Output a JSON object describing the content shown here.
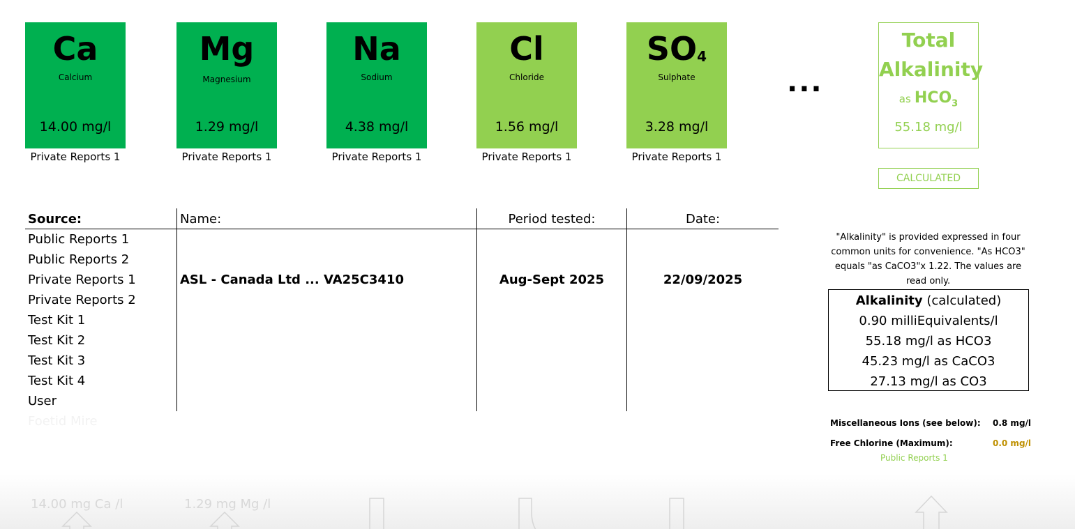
{
  "ions": [
    {
      "symbol": "Ca",
      "subscript": "",
      "name": "Calcium",
      "value": "14.00 mg/l",
      "source": "Private Reports 1",
      "color": "#00b050"
    },
    {
      "symbol": "Mg",
      "subscript": "",
      "name": "Magnesium",
      "value": "1.29 mg/l",
      "source": "Private Reports 1",
      "color": "#00b050"
    },
    {
      "symbol": "Na",
      "subscript": "",
      "name": "Sodium",
      "value": "4.38 mg/l",
      "source": "Private Reports 1",
      "color": "#00b050"
    },
    {
      "symbol": "Cl",
      "subscript": "",
      "name": "Chloride",
      "value": "1.56 mg/l",
      "source": "Private Reports 1",
      "color": "#92d050"
    },
    {
      "symbol": "SO",
      "subscript": "4",
      "name": "Sulphate",
      "value": "3.28 mg/l",
      "source": "Private Reports 1",
      "color": "#92d050"
    }
  ],
  "ellipsis": "...",
  "total_alkalinity": {
    "line1": "Total",
    "line2": "Alkalinity",
    "as": "as",
    "formula": "HCO",
    "formula_sub": "3",
    "value": "55.18 mg/l",
    "badge": "CALCULATED",
    "color": "#92d050"
  },
  "table": {
    "headers": {
      "source": "Source:",
      "name": "Name:",
      "period": "Period tested:",
      "date": "Date:"
    },
    "sources": [
      "Public Reports 1",
      "Public Reports 2",
      "Private Reports 1",
      "Private Reports 2",
      "Test Kit 1",
      "Test Kit 2",
      "Test Kit 3",
      "Test Kit 4",
      "User",
      "Foetid Mire"
    ],
    "selected_row": {
      "name": "ASL - Canada Ltd ... VA25C3410",
      "period": "Aug-Sept 2025",
      "date": "22/09/2025"
    }
  },
  "alkalinity_note": "\"Alkalinity\" is provided expressed in four common units for convenience. \"As HCO3\" equals \"as CaCO3\"x 1.22. The values are read only.",
  "alkalinity_calc": {
    "title_bold": "Alkalinity",
    "title_rest": " (calculated)",
    "rows": [
      "0.90 milliEquivalents/l",
      "55.18 mg/l as HCO3",
      "45.23 mg/l as CaCO3",
      "27.13 mg/l as CO3"
    ]
  },
  "misc": {
    "misc_label": "Miscellaneous Ions (see below):",
    "misc_value": "0.8 mg/l",
    "chlorine_label": "Free Chlorine (Maximum):",
    "chlorine_value": "0.0 mg/l",
    "chlorine_color": "#bf9000",
    "chlorine_source": "Public Reports 1"
  },
  "bottom_faded": {
    "ca": "14.00 mg Ca /l",
    "mg": "1.29 mg Mg /l"
  }
}
